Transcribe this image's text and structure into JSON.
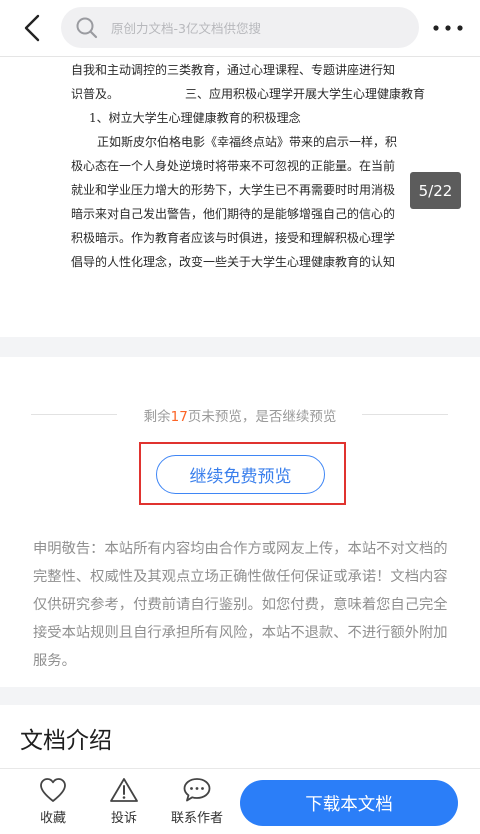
{
  "header": {
    "search_placeholder": "原创力文档-3亿文档供您搜"
  },
  "document": {
    "lines": [
      "自我和主动调控的三类教育，通过心理课程、专题讲座进行知",
      "识普及。",
      "三、应用积极心理学开展大学生心理健康教育",
      "1、树立大学生心理健康教育的积极理念",
      "正如斯皮尔伯格电影《幸福终点站》带来的启示一样，积",
      "极心态在一个人身处逆境时将带来不可忽视的正能量。在当前",
      "就业和学业压力增大的形势下，大学生已不再需要时时用消极",
      "暗示来对自己发出警告，他们期待的是能够增强自己的信心的",
      "积极暗示。作为教育者应该与时俱进，接受和理解积极心理学",
      "倡导的人性化理念，改变一些关于大学生心理健康教育的认知"
    ],
    "page_indicator": "5/22"
  },
  "preview": {
    "remain_prefix": "剩余",
    "remain_count": "17",
    "remain_suffix": "页未预览，是否继续预览",
    "continue_label": "继续免费预览",
    "declaration": "申明敬告：本站所有内容均由合作方或网友上传，本站不对文档的完整性、权威性及其观点立场正确性做任何保证或承诺！文档内容仅供研究参考，付费前请自行鉴别。如您付费，意味着您自己完全接受本站规则且自行承担所有风险，本站不退款、不进行额外附加服务。"
  },
  "intro": {
    "title": "文档介绍"
  },
  "bottom": {
    "favorite_label": "收藏",
    "report_label": "投诉",
    "contact_label": "联系作者",
    "download_label": "下载本文档"
  },
  "colors": {
    "accent": "#2b7ef8",
    "highlight": "#fc6426",
    "annotation_box": "#e0332f"
  }
}
